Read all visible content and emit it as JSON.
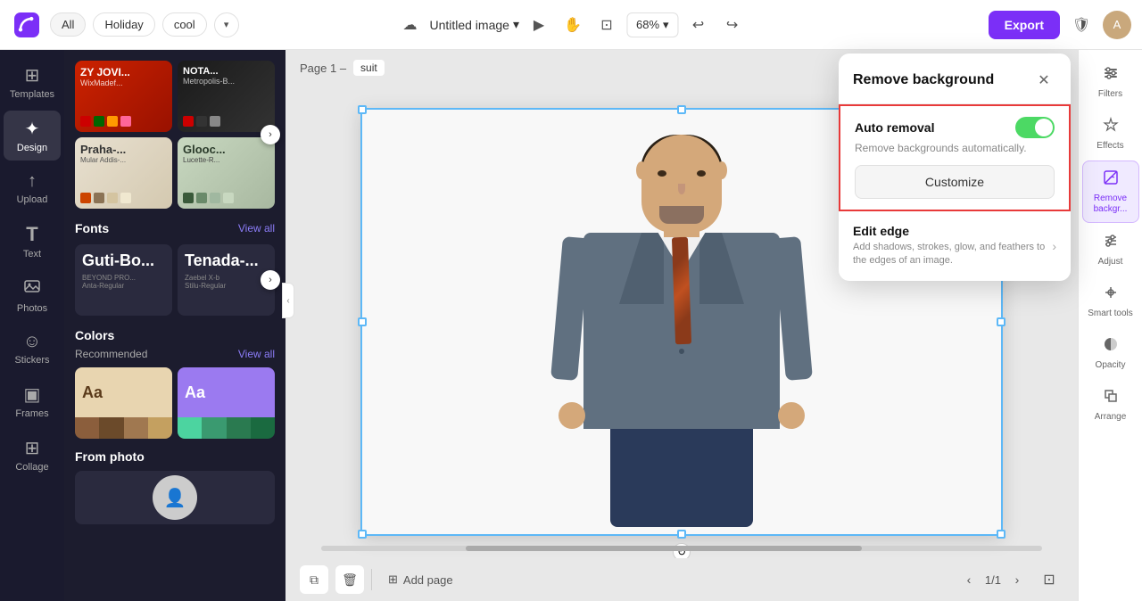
{
  "topbar": {
    "logo": "canva-logo",
    "tags": [
      "All",
      "Holiday",
      "cool"
    ],
    "dropdown_label": "▾",
    "title": "Untitled image",
    "title_caret": "▾",
    "cloud_icon": "☁",
    "tools": {
      "select": "▶",
      "hand": "✋",
      "resize": "⊡",
      "zoom": "68%",
      "zoom_caret": "▾",
      "undo": "↩",
      "redo": "↪"
    },
    "export_label": "Export",
    "shield_icon": "🛡",
    "avatar_initials": "A"
  },
  "left_sidebar": {
    "items": [
      {
        "id": "templates",
        "icon": "⊞",
        "label": "Templates"
      },
      {
        "id": "design",
        "icon": "✦",
        "label": "Design"
      },
      {
        "id": "upload",
        "icon": "↑",
        "label": "Upload"
      },
      {
        "id": "text",
        "icon": "T",
        "label": "Text"
      },
      {
        "id": "photos",
        "icon": "⊡",
        "label": "Photos"
      },
      {
        "id": "stickers",
        "icon": "☺",
        "label": "Stickers"
      },
      {
        "id": "frames",
        "icon": "▣",
        "label": "Frames"
      },
      {
        "id": "collage",
        "icon": "⊞",
        "label": "Collage"
      }
    ]
  },
  "left_panel": {
    "template_tags": [
      "All",
      "Holiday",
      "cool"
    ],
    "templates": [
      {
        "id": "zy-jovi",
        "title": "ZY JOVI...",
        "subtitle": "WixMadef...",
        "type": "zy"
      },
      {
        "id": "nota",
        "title": "NOTA...",
        "subtitle": "Metropolis-B...",
        "type": "nota"
      },
      {
        "id": "praho",
        "title": "Praha-...",
        "subtitle": "Mular Addis-...",
        "type": "praho"
      },
      {
        "id": "glooc",
        "title": "Glooc...",
        "subtitle": "Lucette-R...",
        "type": "glooc"
      }
    ],
    "fonts_title": "Fonts",
    "view_all": "View all",
    "fonts": [
      {
        "name": "Guti-Bo...",
        "sub1": "BEYOND PRO...",
        "sub2": "Anta-Regular"
      },
      {
        "name": "Tenada-...",
        "sub1": "Zaebel X-b",
        "sub2": "Stilu-Regular"
      }
    ],
    "colors_title": "Colors",
    "recommended_label": "Recommended",
    "swatches": [
      {
        "top_bg": "#e8d5b0",
        "letter": "Aa",
        "letter_color": "#5a3a1a",
        "bottoms": [
          "#8b5e3c",
          "#6b4a2a",
          "#a07850",
          "#c4a060"
        ]
      },
      {
        "top_bg": "#9b7af0",
        "letter": "Aa",
        "letter_color": "#fff",
        "bottoms": [
          "#4cd4a0",
          "#3a9a70",
          "#2a7a50",
          "#1a6a40"
        ]
      }
    ],
    "from_photo_title": "From photo"
  },
  "canvas": {
    "page_label": "Page 1 –",
    "suit_tag": "suit",
    "add_page_label": "Add page",
    "page_indicator": "1/1"
  },
  "right_sidebar": {
    "items": [
      {
        "id": "filters",
        "icon": "▤",
        "label": "Filters"
      },
      {
        "id": "effects",
        "icon": "✦",
        "label": "Effects"
      },
      {
        "id": "remove-bg",
        "icon": "⊡",
        "label": "Remove backgr...",
        "active": true
      },
      {
        "id": "adjust",
        "icon": "≡",
        "label": "Adjust"
      },
      {
        "id": "smart-tools",
        "icon": "⊹",
        "label": "Smart tools"
      },
      {
        "id": "opacity",
        "icon": "◐",
        "label": "Opacity"
      },
      {
        "id": "arrange",
        "icon": "⊟",
        "label": "Arrange"
      }
    ]
  },
  "remove_bg_panel": {
    "title": "Remove background",
    "close_icon": "✕",
    "auto_removal": {
      "title": "Auto removal",
      "description": "Remove backgrounds automatically.",
      "toggle_state": "on",
      "customize_label": "Customize"
    },
    "edit_edge": {
      "title": "Edit edge",
      "description": "Add shadows, strokes, glow, and feathers to the edges of an image.",
      "chevron": "›"
    }
  }
}
